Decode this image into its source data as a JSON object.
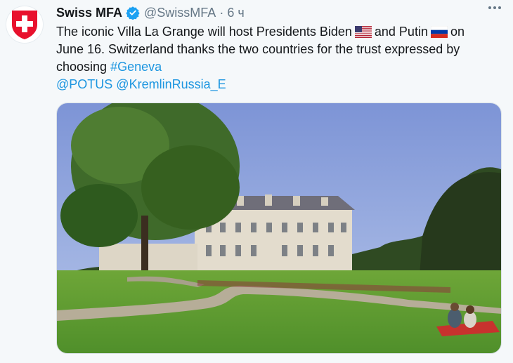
{
  "account": {
    "name": "Swiss MFA",
    "handle": "@SwissMFA",
    "separator": "·",
    "time": "6 ч",
    "verified": true,
    "avatar_icon": "swiss-cross-shield-icon"
  },
  "tweet": {
    "text_before_biden": "The iconic Villa La Grange will host Presidents Biden",
    "text_between_flags": "and Putin",
    "text_after_russia": "on",
    "line2": "June 16. Switzerland thanks the two countries for the trust expressed by",
    "line3_prefix": "choosing",
    "hashtag": "#Geneva",
    "mention_potus": "@POTUS",
    "mention_kremlin": "@KremlinRussia_E",
    "flags": [
      "us-flag-icon",
      "russia-flag-icon"
    ]
  },
  "colors": {
    "link": "#1b95e0",
    "secondary": "#657786",
    "swiss_red": "#ff0000"
  }
}
